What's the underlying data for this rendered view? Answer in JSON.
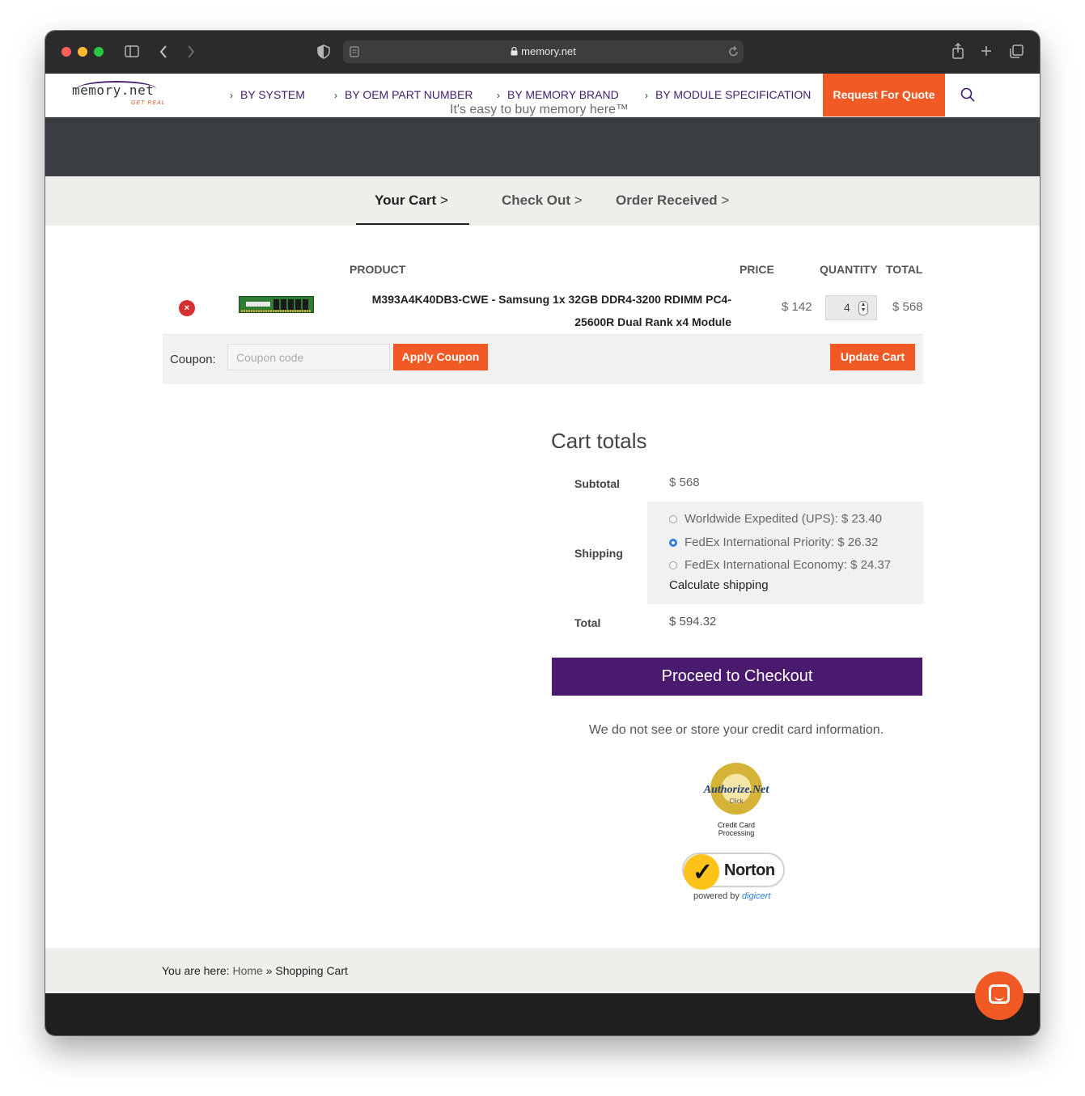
{
  "browser": {
    "url": "memory.net"
  },
  "logo": {
    "text": "memory.net",
    "tagline": "GET REAL"
  },
  "nav": {
    "items": [
      {
        "label": "BY SYSTEM"
      },
      {
        "label": "BY OEM PART NUMBER"
      },
      {
        "label": "BY MEMORY BRAND"
      },
      {
        "label": "BY MODULE SPECIFICATION"
      }
    ],
    "cta": "Request For Quote"
  },
  "hero": {
    "text": "It's easy to buy memory here™"
  },
  "steps": [
    {
      "label": "Your Cart"
    },
    {
      "label": "Check Out"
    },
    {
      "label": "Order Received"
    }
  ],
  "cart": {
    "headers": {
      "product": "PRODUCT",
      "price": "PRICE",
      "quantity": "QUANTITY",
      "total": "TOTAL"
    },
    "items": [
      {
        "name_line1": "M393A4K40DB3-CWE - Samsung 1x 32GB DDR4-3200 RDIMM PC4-",
        "name_line2": "25600R Dual Rank x4 Module",
        "price": "$ 142",
        "quantity": "4",
        "total": "$ 568"
      }
    ],
    "coupon_label": "Coupon:",
    "coupon_placeholder": "Coupon code",
    "apply_coupon": "Apply Coupon",
    "update_cart": "Update Cart"
  },
  "totals": {
    "title": "Cart totals",
    "subtotal_label": "Subtotal",
    "subtotal": "$ 568",
    "shipping_label": "Shipping",
    "shipping_options": [
      {
        "label": "Worldwide Expedited (UPS): $ 23.40",
        "selected": false
      },
      {
        "label": "FedEx International Priority: $ 26.32",
        "selected": true
      },
      {
        "label": "FedEx International Economy: $ 24.37",
        "selected": false
      }
    ],
    "calculate_shipping": "Calculate shipping",
    "total_label": "Total",
    "total": "$ 594.32",
    "checkout": "Proceed to Checkout",
    "cc_note": "We do not see or store your credit card information."
  },
  "badges": {
    "authorize": "Authorize.Net",
    "authorize_click": "Click",
    "authorize_caption_1": "Credit Card",
    "authorize_caption_2": "Processing",
    "norton": "Norton",
    "norton_powered": "powered by",
    "norton_brand": "digicert"
  },
  "breadcrumb": {
    "prefix": "You are here:",
    "home": "Home",
    "sep": "»",
    "current": "Shopping Cart"
  },
  "colors": {
    "accent": "#f15a24",
    "brand_purple": "#4a1a6e",
    "nav_text": "#3f1f6b"
  }
}
